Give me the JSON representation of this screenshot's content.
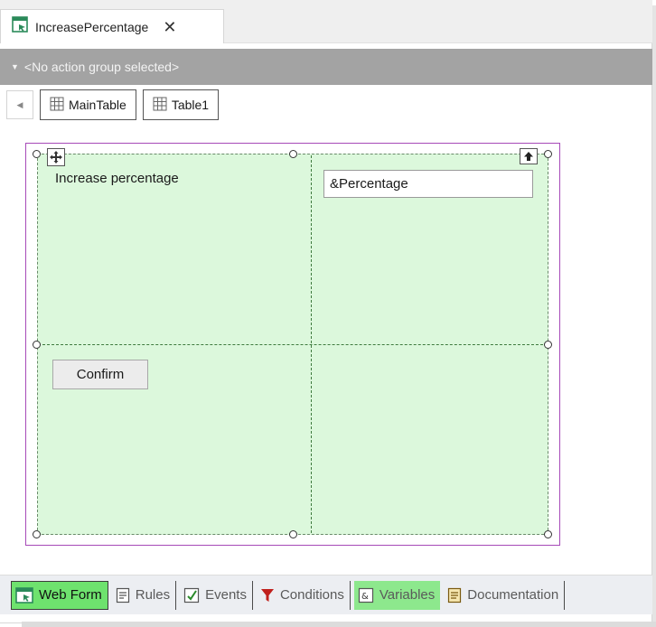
{
  "tab": {
    "title": "IncreasePercentage",
    "close": "✕"
  },
  "action_bar": {
    "label": "<No action group selected>"
  },
  "breadcrumb": {
    "items": [
      "MainTable",
      "Table1"
    ]
  },
  "form": {
    "label_text": "Increase percentage",
    "field_value": "&Percentage",
    "button_label": "Confirm"
  },
  "bottom_tabs": [
    {
      "label": "Web Form",
      "icon": "webform-icon"
    },
    {
      "label": "Rules",
      "icon": "rules-icon"
    },
    {
      "label": "Events",
      "icon": "events-icon"
    },
    {
      "label": "Conditions",
      "icon": "filter-icon"
    },
    {
      "label": "Variables",
      "icon": "variables-icon"
    },
    {
      "label": "Documentation",
      "icon": "documentation-icon"
    }
  ],
  "colors": {
    "cell_fill": "#dcf8dc",
    "outer_border": "#a64ab8",
    "active_tab": "#6ee26e",
    "action_bar": "#a3a3a3"
  }
}
